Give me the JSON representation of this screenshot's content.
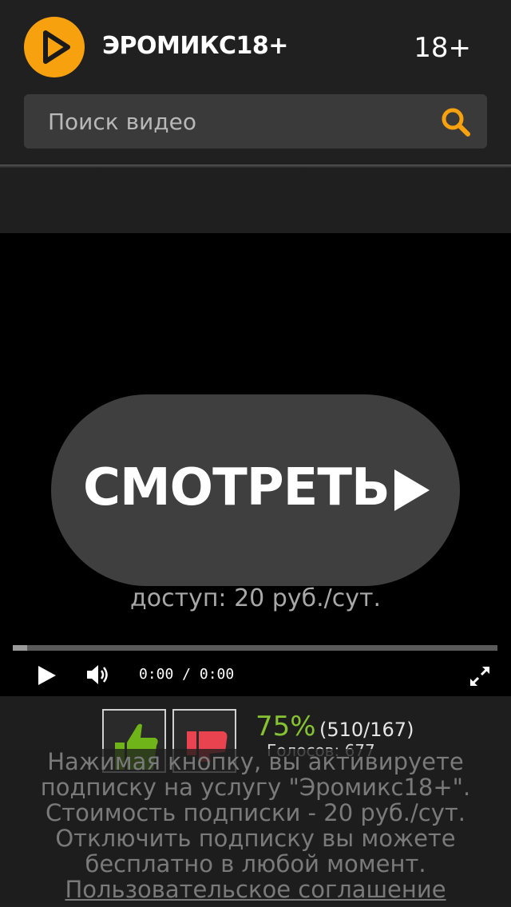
{
  "header": {
    "brand": "ЭРОМИКС18+",
    "age_label": "18+",
    "logo_icon": "play-logo-icon",
    "accent_color": "#f7a10f"
  },
  "search": {
    "placeholder": "Поиск видео",
    "icon": "search-icon"
  },
  "player": {
    "watch_label": "СМОТРЕТЬ",
    "price_text": "доступ: 20 руб./сут.",
    "time_display": "0:00 / 0:00",
    "progress_fraction": 0.03,
    "icons": [
      "play-icon",
      "volume-icon",
      "fullscreen-icon"
    ]
  },
  "rating": {
    "percent": "75%",
    "counts": "(510/167)",
    "total": "Голосов: 677",
    "up_icon": "thumbs-up-icon",
    "down_icon": "thumbs-down-icon",
    "percent_color": "#86c232"
  },
  "notice": {
    "lines": [
      "Нажимая кнопку, вы активируете",
      "подписку на услугу \"Эромикс18+\".",
      "Стоимость подписки - 20 руб./сут.",
      "Отключить подписку вы можете",
      "бесплатно в любой момент."
    ],
    "agreement_link": "Пользовательское соглашение"
  }
}
